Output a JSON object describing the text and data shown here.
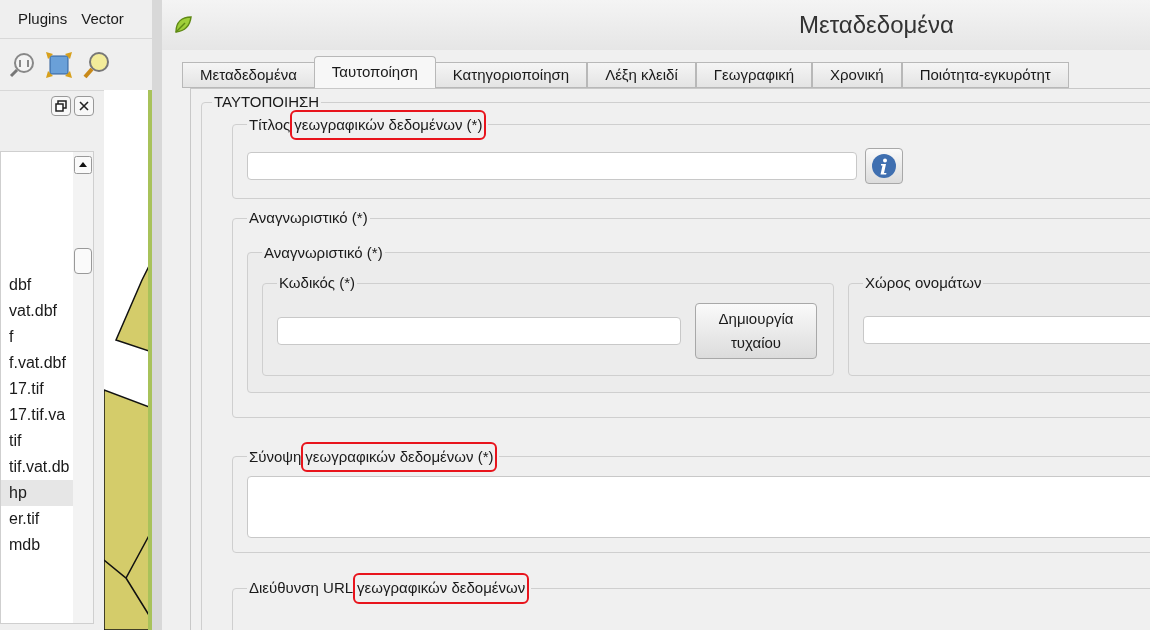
{
  "qgis": {
    "menu": [
      "Plugins",
      "Vector"
    ],
    "browser_items": [
      {
        "label": "dbf",
        "selected": false
      },
      {
        "label": "vat.dbf",
        "selected": false
      },
      {
        "label": "f",
        "selected": false
      },
      {
        "label": "f.vat.dbf",
        "selected": false
      },
      {
        "label": "17.tif",
        "selected": false
      },
      {
        "label": "17.tif.va",
        "selected": false
      },
      {
        "label": "tif",
        "selected": false
      },
      {
        "label": "tif.vat.db",
        "selected": false
      },
      {
        "label": "hp",
        "selected": true
      },
      {
        "label": "er.tif",
        "selected": false
      },
      {
        "label": "mdb",
        "selected": false
      }
    ]
  },
  "dialog": {
    "title": "Μεταδεδομένα",
    "tabs": [
      {
        "label": "Μεταδεδομένα",
        "selected": false
      },
      {
        "label": "Ταυτοποίηση",
        "selected": true
      },
      {
        "label": "Κατηγοριοποίηση",
        "selected": false
      },
      {
        "label": "Λέξη κλειδί",
        "selected": false
      },
      {
        "label": "Γεωγραφική",
        "selected": false
      },
      {
        "label": "Χρονική",
        "selected": false
      },
      {
        "label": "Ποιότητα-εγκυρότητ",
        "selected": false
      }
    ],
    "section": {
      "title": "ΤΑΥΤΟΠΟΙΗΣΗ",
      "groups": [
        {
          "kind": "text_field",
          "label": "Τίτλος",
          "highlight": "γεωγραφικών δεδομένων (*)"
        },
        {
          "kind": "identifier",
          "label": "Αναγνωριστικό (*)",
          "inner_label": "Αναγνωριστικό (*)",
          "code_label": "Κωδικός (*)",
          "button": "Δημιουργία τυχαίου",
          "namespace_label": "Χώρος ονομάτων"
        },
        {
          "kind": "text_area",
          "label": "Σύνοψη",
          "highlight": "γεωγραφικών δεδομένων (*)"
        },
        {
          "kind": "cut",
          "label": "Διεύθυνση URL",
          "highlight": "γεωγραφικών δεδομένων"
        }
      ]
    }
  }
}
